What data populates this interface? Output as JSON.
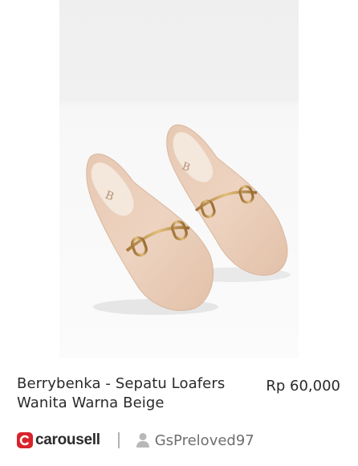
{
  "listing": {
    "title": "Berrybenka - Sepatu Loafers Wanita Warna Beige",
    "price": "Rp 60,000",
    "image_subject": "beige-loafers-photo"
  },
  "footer": {
    "brand": "carousell",
    "seller": "GsPreloved97"
  },
  "colors": {
    "brand_red": "#d8232a",
    "text": "#2a2a2a",
    "muted": "#6f6f6f",
    "divider": "#b3b3b3"
  },
  "icons": [
    "carousell-logo-icon",
    "user-icon"
  ]
}
